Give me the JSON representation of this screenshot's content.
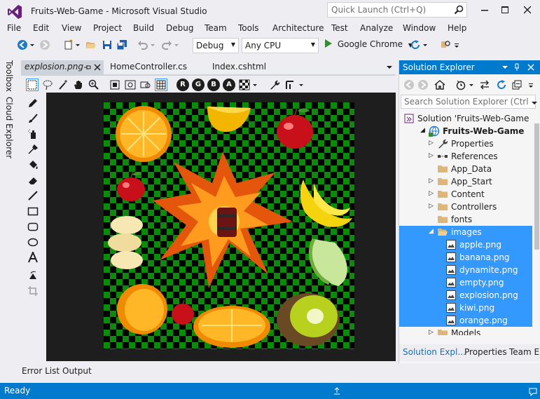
{
  "window": {
    "title": "Fruits-Web-Game - Microsoft Visual Studio",
    "quick_launch_placeholder": "Quick Launch (Ctrl+Q)"
  },
  "menu": [
    "File",
    "Edit",
    "View",
    "Project",
    "Build",
    "Debug",
    "Team",
    "Tools",
    "Architecture",
    "Test",
    "Analyze",
    "Window",
    "Help"
  ],
  "toolbar": {
    "configuration": "Debug",
    "platform": "Any CPU",
    "run_target": "Google Chrome"
  },
  "side_tabs": [
    "Toolbox",
    "Cloud Explorer"
  ],
  "doc_tabs": [
    "explosion.png",
    "HomeController.cs",
    "Index.cshtml"
  ],
  "image_editor": {
    "channel_buttons": [
      "R",
      "G",
      "B",
      "A"
    ]
  },
  "bottom_tabs": [
    "Error List",
    "Output"
  ],
  "status": {
    "text": "Ready"
  },
  "solution_explorer": {
    "title": "Solution Explorer",
    "search_placeholder": "Search Solution Explorer (Ctrl",
    "tree": [
      {
        "label": "Solution 'Fruits-Web-Game",
        "icon": "solution-icon",
        "arrow": "",
        "selected": false
      },
      {
        "label": "Fruits-Web-Game",
        "icon": "web-project-icon",
        "arrow": "expanded",
        "selected": false
      },
      {
        "label": "Properties",
        "icon": "wrench-icon",
        "arrow": "collapsed",
        "selected": false
      },
      {
        "label": "References",
        "icon": "references-icon",
        "arrow": "collapsed",
        "selected": false
      },
      {
        "label": "App_Data",
        "icon": "folder-icon",
        "arrow": "",
        "selected": false
      },
      {
        "label": "App_Start",
        "icon": "folder-icon",
        "arrow": "collapsed",
        "selected": false
      },
      {
        "label": "Content",
        "icon": "folder-icon",
        "arrow": "collapsed",
        "selected": false
      },
      {
        "label": "Controllers",
        "icon": "folder-icon",
        "arrow": "collapsed",
        "selected": false
      },
      {
        "label": "fonts",
        "icon": "folder-icon",
        "arrow": "",
        "selected": false
      },
      {
        "label": "images",
        "icon": "folder-open-icon",
        "arrow": "expanded",
        "selected": true
      },
      {
        "label": "apple.png",
        "icon": "image-file-icon",
        "arrow": "",
        "selected": true
      },
      {
        "label": "banana.png",
        "icon": "image-file-icon",
        "arrow": "",
        "selected": true
      },
      {
        "label": "dynamite.png",
        "icon": "image-file-icon",
        "arrow": "",
        "selected": true
      },
      {
        "label": "empty.png",
        "icon": "image-file-icon",
        "arrow": "",
        "selected": true
      },
      {
        "label": "explosion.png",
        "icon": "image-file-icon",
        "arrow": "",
        "selected": true
      },
      {
        "label": "kiwi.png",
        "icon": "image-file-icon",
        "arrow": "",
        "selected": true
      },
      {
        "label": "orange.png",
        "icon": "image-file-icon",
        "arrow": "",
        "selected": true
      },
      {
        "label": "Models",
        "icon": "folder-icon",
        "arrow": "collapsed",
        "selected": false
      }
    ],
    "bottom_tabs": [
      "Solution Expl...",
      "Properties",
      "Team E"
    ]
  },
  "colors": {
    "accent": "#007acc",
    "selection": "#3399ff",
    "checker_green": "#0a8c0a",
    "canvas_bg": "#1e1e1e"
  }
}
